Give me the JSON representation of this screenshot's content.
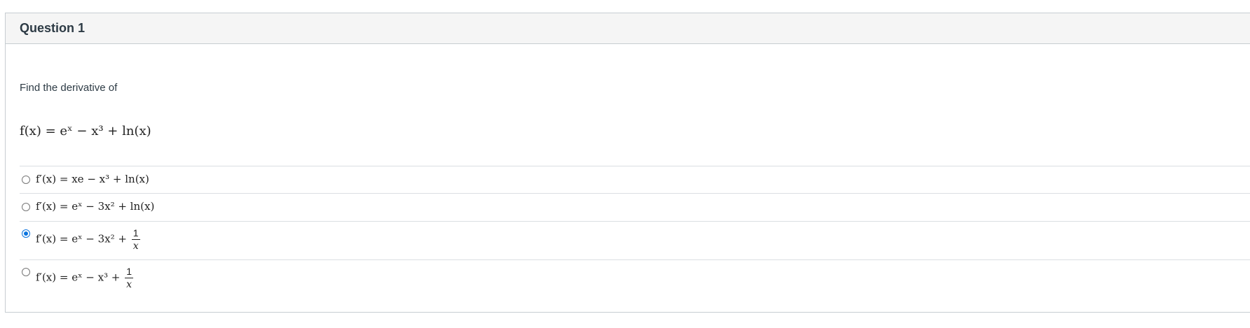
{
  "question": {
    "title": "Question 1",
    "prompt": "Find the derivative of",
    "given": "f(x) = eˣ − x³ + ln(x)"
  },
  "answers": [
    {
      "text": "f′(x) = xe − x³ + ln(x)",
      "selected": false
    },
    {
      "text": "f′(x) = eˣ − 3x² + ln(x)",
      "selected": false
    },
    {
      "prefix": "f′(x) = eˣ − 3x² +",
      "numerator": "1",
      "denominator": "x",
      "selected": true
    },
    {
      "prefix": "f′(x) = eˣ − x³ +",
      "numerator": "1",
      "denominator": "x",
      "selected": false
    }
  ],
  "colors": {
    "accent": "#0b74de",
    "header_bg": "#f5f5f5",
    "border": "#c7cdd1",
    "text": "#2d3b45"
  }
}
